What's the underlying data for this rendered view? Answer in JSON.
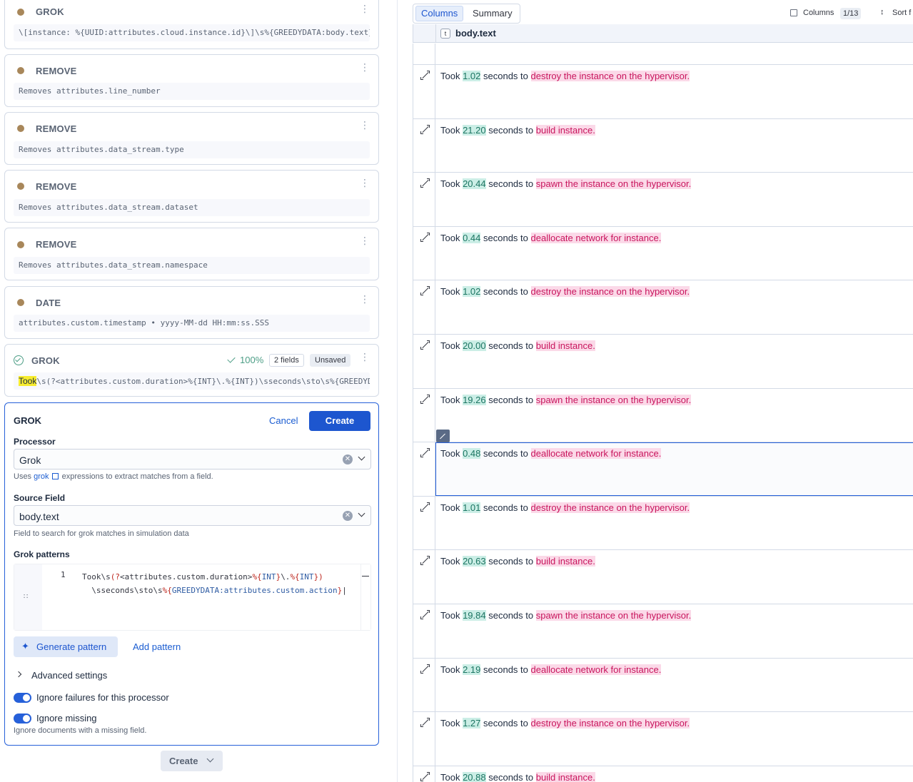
{
  "processors": [
    {
      "type": "GROK",
      "description": "\\[instance: %{UUID:attributes.cloud.instance.id}\\]\\s%{GREEDYDATA:body.text}"
    },
    {
      "type": "REMOVE",
      "description": "Removes attributes.line_number"
    },
    {
      "type": "REMOVE",
      "description": "Removes attributes.data_stream.type"
    },
    {
      "type": "REMOVE",
      "description": "Removes attributes.data_stream.dataset"
    },
    {
      "type": "REMOVE",
      "description": "Removes attributes.data_stream.namespace"
    },
    {
      "type": "DATE",
      "description": "attributes.custom.timestamp • yyyy-MM-dd HH:mm:ss.SSS"
    }
  ],
  "draft": {
    "type": "GROK",
    "match_rate": "100%",
    "fields_badge": "2 fields",
    "status_badge": "Unsaved",
    "pattern_highlight": "Took",
    "pattern_rest": "\\s(?<attributes.custom.duration>%{INT}\\.%{INT})\\sseconds\\sto\\s%{GREEDYDATA:attributes.custom.action}"
  },
  "editor": {
    "title": "GROK",
    "cancel_label": "Cancel",
    "create_label": "Create",
    "processor_label": "Processor",
    "processor_value": "Grok",
    "processor_help_pre": "Uses ",
    "processor_help_link": "grok",
    "processor_help_post": " expressions to extract matches from a field.",
    "source_label": "Source Field",
    "source_value": "body.text",
    "source_help": "Field to search for grok matches in simulation data",
    "patterns_label": "Grok patterns",
    "line_number": "1",
    "code_line1_a": "Took\\s",
    "code_line1_b": "(?",
    "code_line1_c": "<attributes.custom.duration>",
    "code_line1_d": "%{",
    "code_line1_e": "INT",
    "code_line1_f": "}",
    "code_line1_g": "\\.",
    "code_line1_h": "%{",
    "code_line1_i": "INT",
    "code_line1_j": "})",
    "code_line2_a": "\\sseconds\\sto\\s",
    "code_line2_b": "%{",
    "code_line2_c": "GREEDYDATA:attributes.custom.action",
    "code_line2_d": "}",
    "generate_label": "Generate pattern",
    "add_pattern_label": "Add pattern",
    "advanced_label": "Advanced settings",
    "ignore_failures_label": "Ignore failures for this processor",
    "ignore_missing_label": "Ignore missing",
    "ignore_missing_help": "Ignore documents with a missing field."
  },
  "bottom_create_label": "Create",
  "table": {
    "tab_columns": "Columns",
    "tab_summary": "Summary",
    "columns_label": "Columns",
    "columns_count": "1/13",
    "sort_label": "Sort f",
    "column_type": "t",
    "column_name": "body.text",
    "rows": [
      {
        "pre": "Took ",
        "num": "1.02",
        "mid": " seconds to ",
        "act": "destroy the instance on the hypervisor."
      },
      {
        "pre": "Took ",
        "num": "21.20",
        "mid": " seconds to ",
        "act": "build instance."
      },
      {
        "pre": "Took ",
        "num": "20.44",
        "mid": " seconds to ",
        "act": "spawn the instance on the hypervisor."
      },
      {
        "pre": "Took ",
        "num": "0.44",
        "mid": " seconds to ",
        "act": "deallocate network for instance."
      },
      {
        "pre": "Took ",
        "num": "1.02",
        "mid": " seconds to ",
        "act": "destroy the instance on the hypervisor."
      },
      {
        "pre": "Took ",
        "num": "20.00",
        "mid": " seconds to ",
        "act": "build instance."
      },
      {
        "pre": "Took ",
        "num": "19.26",
        "mid": " seconds to ",
        "act": "spawn the instance on the hypervisor."
      },
      {
        "pre": "Took ",
        "num": "0.48",
        "mid": " seconds to ",
        "act": "deallocate network for instance."
      },
      {
        "pre": "Took ",
        "num": "1.01",
        "mid": " seconds to ",
        "act": "destroy the instance on the hypervisor."
      },
      {
        "pre": "Took ",
        "num": "20.63",
        "mid": " seconds to ",
        "act": "build instance."
      },
      {
        "pre": "Took ",
        "num": "19.84",
        "mid": " seconds to ",
        "act": "spawn the instance on the hypervisor."
      },
      {
        "pre": "Took ",
        "num": "2.19",
        "mid": " seconds to ",
        "act": "deallocate network for instance."
      },
      {
        "pre": "Took ",
        "num": "1.27",
        "mid": " seconds to ",
        "act": "destroy the instance on the hypervisor."
      },
      {
        "pre": "Took ",
        "num": "20.88",
        "mid": " seconds to ",
        "act": "build instance."
      }
    ]
  }
}
